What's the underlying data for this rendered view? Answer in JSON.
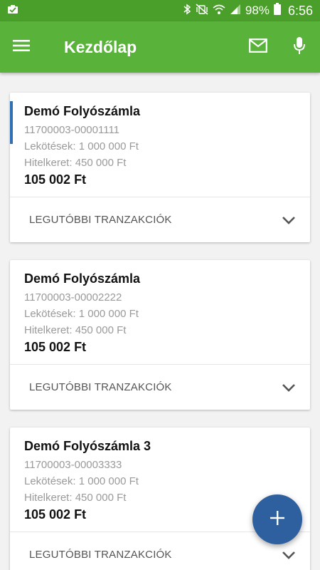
{
  "status_bar": {
    "battery": "98%",
    "time": "6:56"
  },
  "app_bar": {
    "title": "Kezdőlap",
    "icons": [
      "menu-icon",
      "mail-icon",
      "microphone-icon"
    ]
  },
  "accounts": [
    {
      "name": "Demó Folyószámla",
      "number": "11700003-00001111",
      "commitments": "Lekötések: 1 000 000 Ft",
      "credit_line": "Hitelkeret: 450 000 Ft",
      "balance": "105 002 Ft",
      "footer": "LEGUTÓBBI TRANZAKCIÓK"
    },
    {
      "name": "Demó Folyószámla",
      "number": "11700003-00002222",
      "commitments": "Lekötések: 1 000 000 Ft",
      "credit_line": "Hitelkeret: 450 000 Ft",
      "balance": "105 002 Ft",
      "footer": "LEGUTÓBBI TRANZAKCIÓK"
    },
    {
      "name": "Demó Folyószámla 3",
      "number": "11700003-00003333",
      "commitments": "Lekötések: 1 000 000 Ft",
      "credit_line": "Hitelkeret: 450 000 Ft",
      "balance": "105 002 Ft",
      "footer": "LEGUTÓBBI TRANZAKCIÓK"
    }
  ],
  "colors": {
    "status_bar": "#4a9e2a",
    "app_bar": "#59b23a",
    "accent": "#2f6fb5",
    "fab": "#2e5f9e"
  }
}
